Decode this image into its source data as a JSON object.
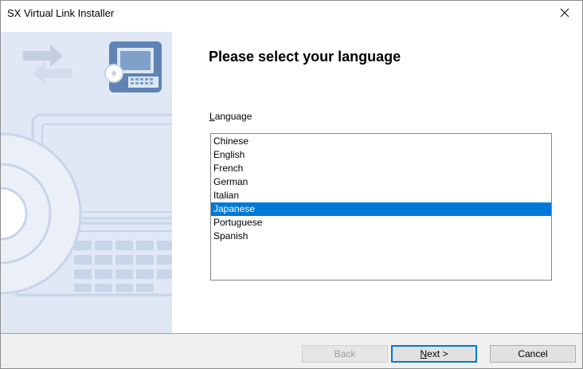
{
  "window": {
    "title": "SX Virtual Link Installer"
  },
  "page": {
    "heading": "Please select your language",
    "language_label_accel": "L",
    "language_label_rest": "anguage"
  },
  "languages": [
    "Chinese",
    "English",
    "French",
    "German",
    "Italian",
    "Japanese",
    "Portuguese",
    "Spanish"
  ],
  "selected_language": "Japanese",
  "buttons": {
    "back": "Back",
    "next_accel": "N",
    "next_rest": "ext >",
    "cancel": "Cancel"
  },
  "colors": {
    "selection": "#0078d7",
    "side_panel": "#dfe8f4",
    "default_button_border": "#0078d7"
  },
  "icons": [
    "close-icon",
    "computer-icon",
    "network-arrows-icon",
    "laptop-illustration",
    "disc-illustration"
  ]
}
